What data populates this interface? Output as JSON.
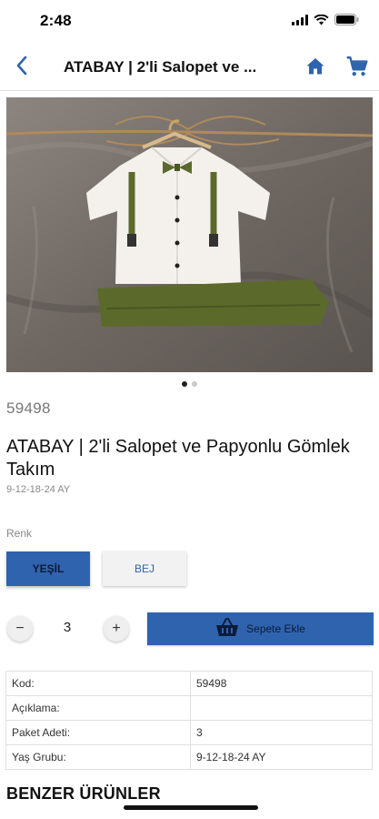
{
  "status_bar": {
    "time": "2:48"
  },
  "nav": {
    "title": "ATABAY | 2'li Salopet ve ..."
  },
  "product": {
    "code": "59498",
    "title": "ATABAY | 2'li Salopet ve Papyonlu Gömlek Takım",
    "age_range": "9-12-18-24 AY"
  },
  "carousel": {
    "count": 2,
    "active_index": 0
  },
  "color": {
    "label": "Renk",
    "options": [
      {
        "label": "YEŞİL",
        "selected": true
      },
      {
        "label": "BEJ",
        "selected": false
      }
    ]
  },
  "quantity": {
    "minus": "−",
    "value": "3",
    "plus": "+"
  },
  "add_to_cart": {
    "label": "Sepete Ekle"
  },
  "details": [
    {
      "key": "Kod:",
      "value": "59498"
    },
    {
      "key": "Açıklama:",
      "value": ""
    },
    {
      "key": "Paket Adeti:",
      "value": "3"
    },
    {
      "key": "Yaş Grubu:",
      "value": "9-12-18-24 AY"
    }
  ],
  "similar": {
    "title": "BENZER ÜRÜNLER"
  },
  "colors": {
    "primary": "#2f63ae",
    "shirt": "#f4f1ec",
    "pants": "#5b6a2b",
    "backdrop": "#7b746f"
  }
}
